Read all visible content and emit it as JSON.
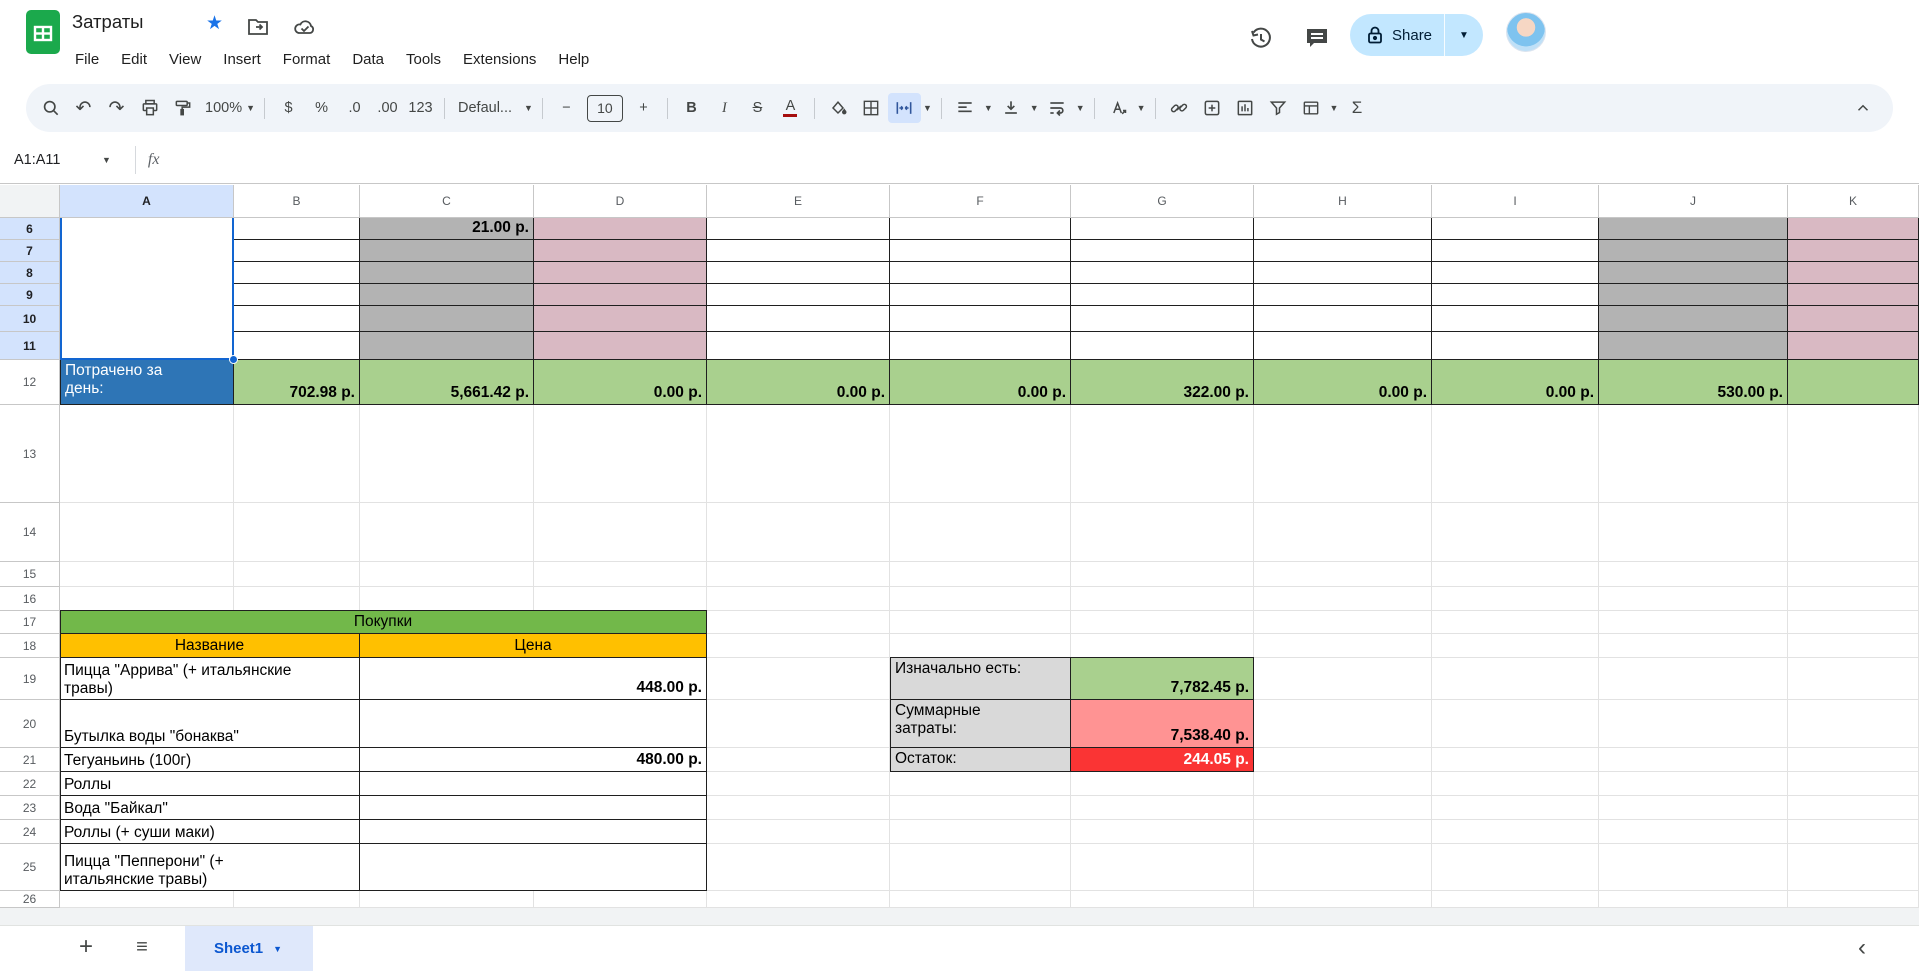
{
  "document": {
    "title": "Затраты"
  },
  "menu_bar": {
    "items": [
      "File",
      "Edit",
      "View",
      "Insert",
      "Format",
      "Data",
      "Tools",
      "Extensions",
      "Help"
    ]
  },
  "top_right": {
    "share_label": "Share"
  },
  "toolbar": {
    "zoom_level": "100%",
    "currency": "$",
    "percent": "%",
    "decrease_decimal": ".0",
    "increase_decimal": ".00",
    "more_formats": "123",
    "font_family": "Defaul...",
    "minus": "−",
    "font_size": "10",
    "plus": "+",
    "bold": "B",
    "italic": "I",
    "strikethrough": "S",
    "text_color": "A",
    "functions": "Σ"
  },
  "formula_bar": {
    "name_box": "A1:A11",
    "fx_label": "fx"
  },
  "grid": {
    "column_letters": [
      "A",
      "B",
      "C",
      "D",
      "E",
      "F",
      "G",
      "H",
      "I",
      "J",
      "K"
    ],
    "row_numbers": [
      6,
      7,
      8,
      9,
      10,
      11,
      12,
      13,
      14,
      15,
      16,
      17,
      18,
      19,
      20,
      21,
      22,
      23,
      24,
      25,
      26
    ],
    "selected_column": "A",
    "selected_row_range": [
      6,
      11
    ],
    "gray_columns": [
      "C",
      "J"
    ],
    "pink_columns": [
      "D",
      "K"
    ],
    "c6_value": "21.00 р."
  },
  "daily_total_row": {
    "row": 12,
    "label": "Потрачено за день:",
    "values": [
      {
        "col": "B",
        "value": "702.98 р."
      },
      {
        "col": "C",
        "value": "5,661.42 р."
      },
      {
        "col": "D",
        "value": "0.00 р."
      },
      {
        "col": "E",
        "value": "0.00 р."
      },
      {
        "col": "F",
        "value": "0.00 р."
      },
      {
        "col": "G",
        "value": "322.00 р."
      },
      {
        "col": "H",
        "value": "0.00 р."
      },
      {
        "col": "I",
        "value": "0.00 р."
      },
      {
        "col": "J",
        "value": "530.00 р."
      },
      {
        "col": "K",
        "value": ""
      }
    ]
  },
  "purchases_table": {
    "title": "Покупки",
    "name_header": "Название",
    "price_header": "Цена",
    "rows": [
      {
        "row": 19,
        "name": "Пицца \"Аррива\" (+ итальянские травы)",
        "price": "448.00 р."
      },
      {
        "row": 20,
        "name": "Бутылка воды \"бонаква\"",
        "price": ""
      },
      {
        "row": 21,
        "name": "Тегуаньинь (100г)",
        "price": "480.00 р."
      },
      {
        "row": 22,
        "name": "Роллы",
        "price": ""
      },
      {
        "row": 23,
        "name": "Вода \"Байкал\"",
        "price": ""
      },
      {
        "row": 24,
        "name": "Роллы (+ суши маки)",
        "price": ""
      },
      {
        "row": 25,
        "name": "Пицца \"Пепперони\" (+ итальянские травы)",
        "price": ""
      }
    ]
  },
  "summary_table": {
    "rows": [
      {
        "row": 19,
        "label": "Изначально есть:",
        "value": "7,782.45 р.",
        "style": "green"
      },
      {
        "row": 20,
        "label": "Суммарные затраты:",
        "value": "7,538.40 р.",
        "style": "salmon"
      },
      {
        "row": 21,
        "label": "Остаток:",
        "value": "244.05 р.",
        "style": "red"
      }
    ]
  },
  "sheet_tabs": {
    "add": "+",
    "active_tab": "Sheet1"
  },
  "colors": {
    "accent_blue": "#2e75b6",
    "row_green": "#a9d08e",
    "table_green": "#72b84a",
    "gold": "#ffc000",
    "gray_cell": "#b3b3b3",
    "pink_cell": "#d9b9c3",
    "label_gray": "#d9d9d9",
    "salmon": "#ff9393",
    "red": "#fa3434",
    "selection": "#1265d1",
    "share_bg": "#c2e7ff"
  }
}
